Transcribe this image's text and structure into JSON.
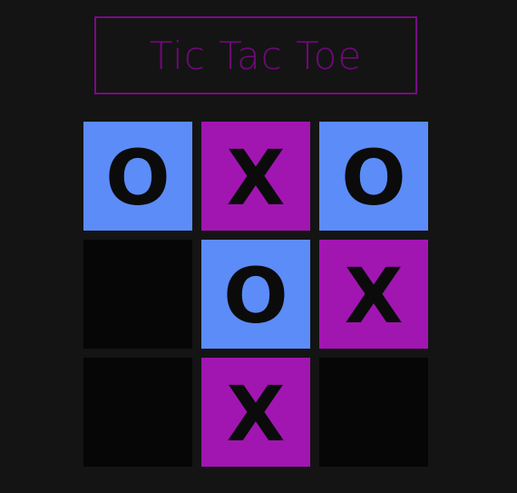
{
  "title": "Tic Tac Toe",
  "colors": {
    "background": "#141414",
    "title_border": "#7a0a84",
    "title_text": "#6e0a78",
    "o_cell": "#5c8cf8",
    "x_cell": "#a116b1",
    "empty_cell": "#060606",
    "mark": "#0b0b0b"
  },
  "board": {
    "cells": [
      "O",
      "X",
      "O",
      "",
      "O",
      "X",
      "",
      "X",
      ""
    ]
  }
}
